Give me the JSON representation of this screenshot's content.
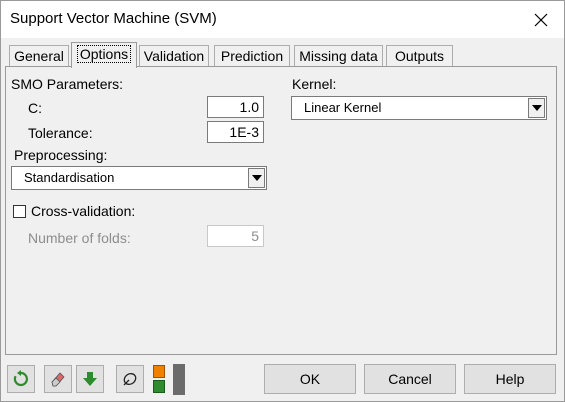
{
  "window": {
    "title": "Support Vector Machine (SVM)"
  },
  "tabs": [
    {
      "label": "General"
    },
    {
      "label": "Options"
    },
    {
      "label": "Validation"
    },
    {
      "label": "Prediction"
    },
    {
      "label": "Missing data"
    },
    {
      "label": "Outputs"
    }
  ],
  "active_tab": "Options",
  "options": {
    "smo_label": "SMO Parameters:",
    "c_label": "C:",
    "c_value": "1.0",
    "tolerance_label": "Tolerance:",
    "tolerance_value": "1E-3",
    "preprocessing_label": "Preprocessing:",
    "preprocessing_value": "Standardisation",
    "kernel_label": "Kernel:",
    "kernel_value": "Linear Kernel",
    "cross_validation_label": "Cross-validation:",
    "cross_validation_checked": false,
    "folds_label": "Number of folds:",
    "folds_value": "5"
  },
  "footer": {
    "ok_label": "OK",
    "cancel_label": "Cancel",
    "help_label": "Help",
    "icons": [
      "reset-icon",
      "eraser-icon",
      "download-arrow-icon",
      "selection-icon",
      "color-toggle-icon"
    ]
  },
  "colors": {
    "accent_green": "#2e8b2e",
    "accent_orange": "#f08000",
    "window_bg": "#f0f0f0"
  }
}
